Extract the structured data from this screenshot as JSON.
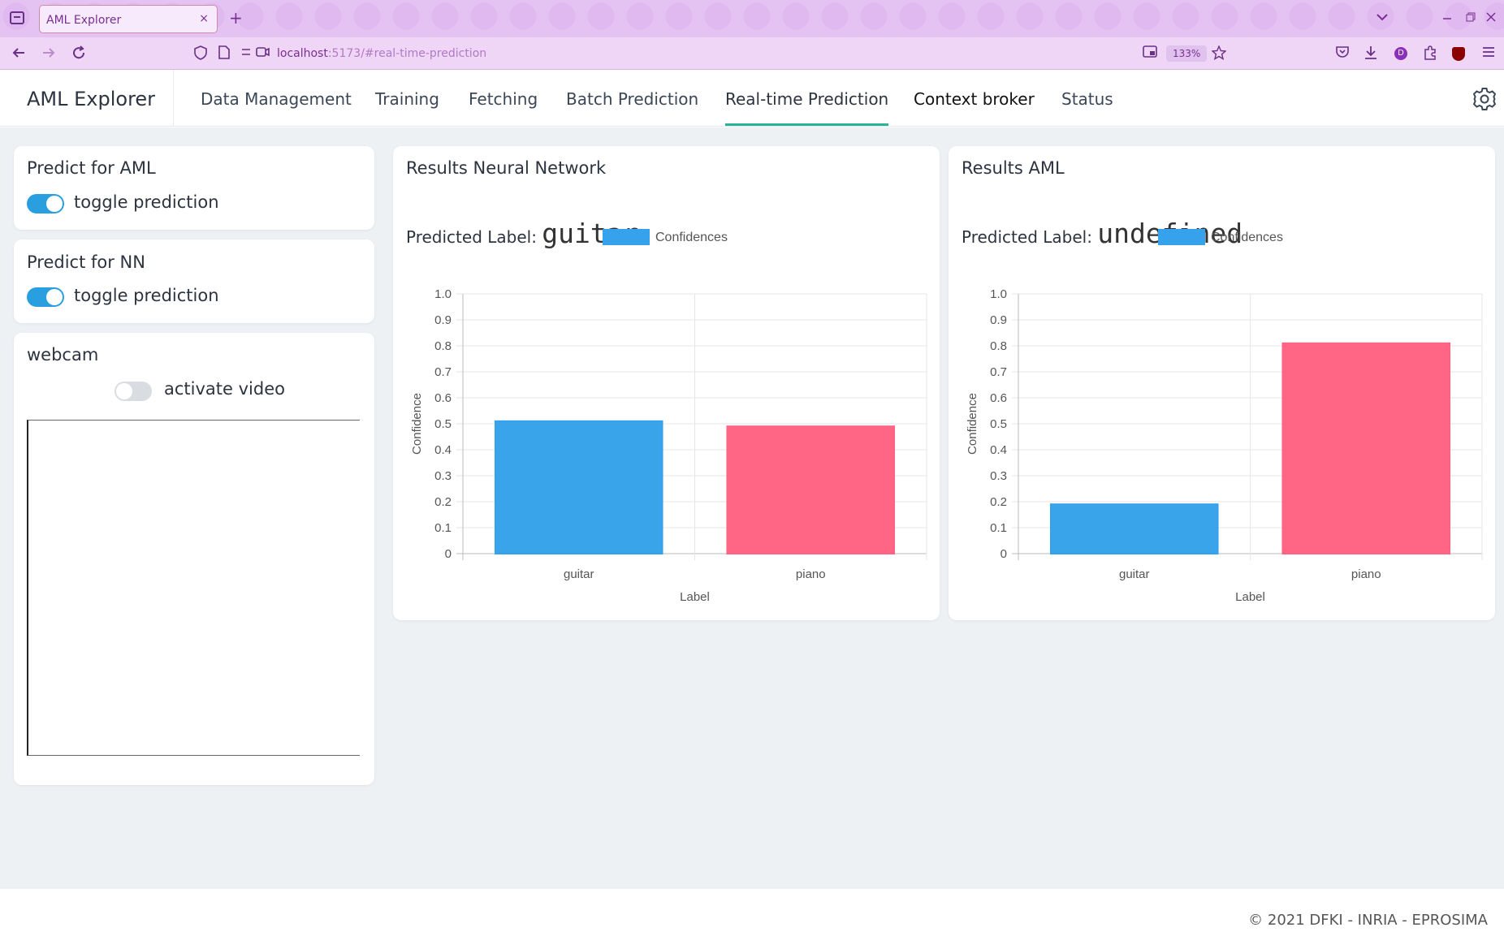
{
  "browser": {
    "tab_title": "AML Explorer",
    "tab_close": "×",
    "new_tab": "+",
    "url_host": "localhost",
    "url_rest": ":5173/#real-time-prediction",
    "zoom": "133%",
    "ext_letter": "D"
  },
  "app": {
    "brand": "AML Explorer",
    "menu": [
      "Data Management",
      "Training",
      "Fetching",
      "Batch Prediction",
      "Real-time Prediction",
      "Context broker",
      "Status"
    ],
    "active_menu": "Real-time Prediction"
  },
  "left": {
    "aml_card": {
      "title": "Predict for AML",
      "toggle_label": "toggle prediction",
      "toggle_on": true
    },
    "nn_card": {
      "title": "Predict for NN",
      "toggle_label": "toggle prediction",
      "toggle_on": true
    },
    "webcam_card": {
      "title": "webcam",
      "toggle_label": "activate video",
      "toggle_on": false
    }
  },
  "results_nn": {
    "title": "Results Neural Network",
    "predicted_prefix": "Predicted Label:",
    "predicted_value": "guitar"
  },
  "results_aml": {
    "title": "Results AML",
    "predicted_prefix": "Predicted Label:",
    "predicted_value": "undefined"
  },
  "colors": {
    "blue": "#36a2eb",
    "red": "#ff6384",
    "accent": "#28b49a"
  },
  "chart_data": [
    {
      "type": "bar",
      "legend": "Confidences",
      "categories": [
        "guitar",
        "piano"
      ],
      "values": [
        0.51,
        0.49
      ],
      "colors": [
        "#36a2eb",
        "#ff6384"
      ],
      "xlabel": "Label",
      "ylabel": "Confidence",
      "ylim": [
        0,
        1.0
      ],
      "yticks": [
        "0",
        "0.1",
        "0.2",
        "0.3",
        "0.4",
        "0.5",
        "0.6",
        "0.7",
        "0.8",
        "0.9",
        "1.0"
      ],
      "grid": true,
      "legend_position": "top"
    },
    {
      "type": "bar",
      "legend": "Confidences",
      "categories": [
        "guitar",
        "piano"
      ],
      "values": [
        0.19,
        0.81
      ],
      "colors": [
        "#36a2eb",
        "#ff6384"
      ],
      "xlabel": "Label",
      "ylabel": "Confidence",
      "ylim": [
        0,
        1.0
      ],
      "yticks": [
        "0",
        "0.1",
        "0.2",
        "0.3",
        "0.4",
        "0.5",
        "0.6",
        "0.7",
        "0.8",
        "0.9",
        "1.0"
      ],
      "grid": true,
      "legend_position": "top"
    }
  ],
  "footer": "© 2021 DFKI - INRIA - EPROSIMA"
}
